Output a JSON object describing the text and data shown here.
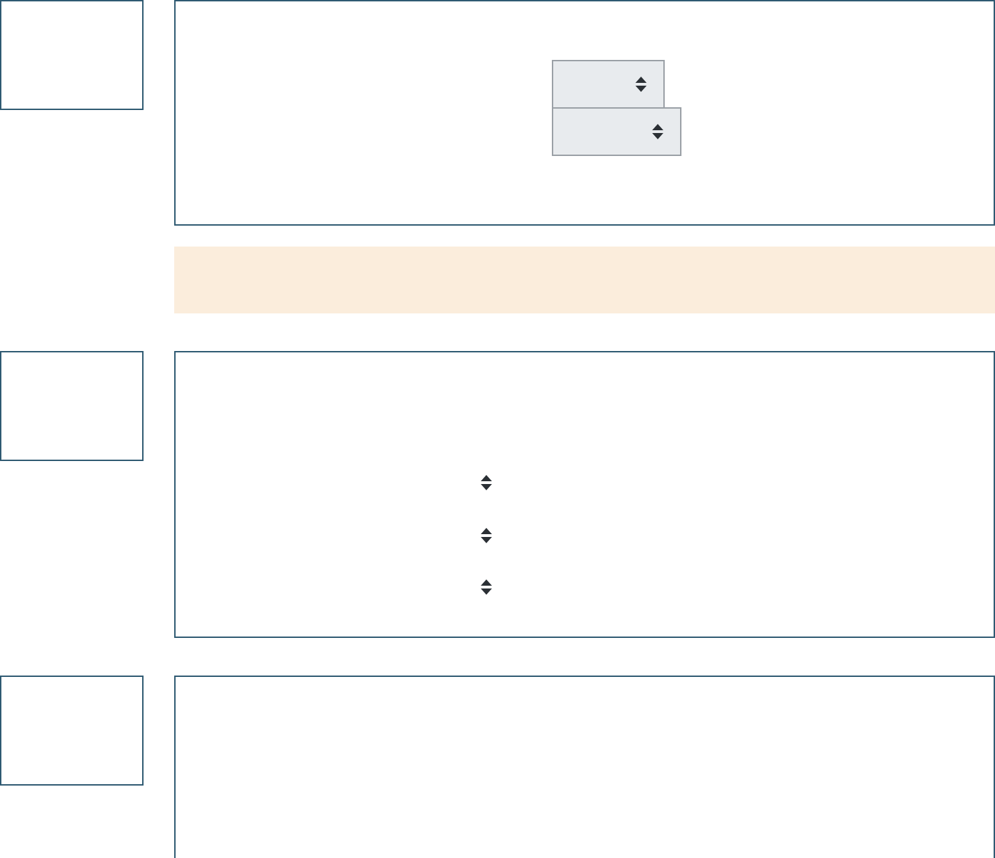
{
  "sections": [
    {
      "notice": true,
      "dropdowns": [
        {
          "kind": "boxed"
        },
        {
          "kind": "boxed"
        }
      ]
    },
    {
      "notice": false,
      "dropdowns": [
        {
          "kind": "bare"
        },
        {
          "kind": "bare"
        },
        {
          "kind": "bare"
        }
      ]
    },
    {
      "notice": false
    }
  ]
}
